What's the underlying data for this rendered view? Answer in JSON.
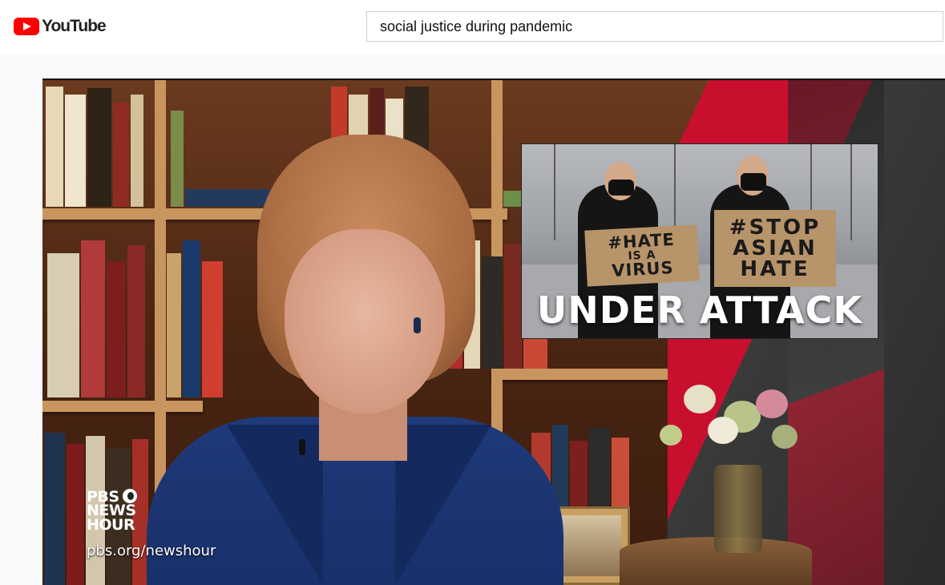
{
  "app": {
    "logo_text": "YouTube",
    "brand_color": "#ff0000"
  },
  "search": {
    "value": "social justice during pandemic"
  },
  "video": {
    "inset_caption": "UNDER ATTACK",
    "sign_left": [
      "#HATE",
      "IS A",
      "VIRUS"
    ],
    "sign_right": [
      "#STOP",
      "ASIAN",
      "HATE"
    ],
    "brand_lines": [
      "PBS",
      "NEWS",
      "HOUR"
    ],
    "brand_url": "pbs.org/newshour",
    "accent_color": "#c8102e"
  }
}
